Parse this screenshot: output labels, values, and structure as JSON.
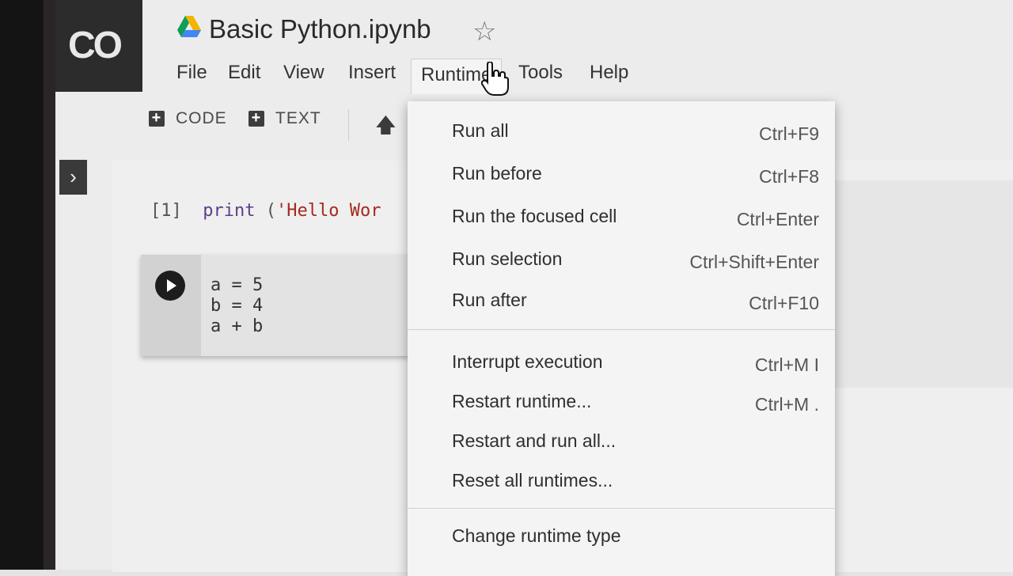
{
  "app": {
    "logo": "CO",
    "title": "Basic Python.ipynb"
  },
  "menubar": {
    "items": [
      "File",
      "Edit",
      "View",
      "Insert",
      "Runtime",
      "Tools",
      "Help"
    ]
  },
  "toolbar": {
    "code_label": "CODE",
    "text_label": "TEXT"
  },
  "cells": {
    "cell1": {
      "exec_count": "[1]",
      "code_keyword": "print",
      "code_paren": " (",
      "code_string": "'Hello Wor"
    },
    "cell2": {
      "lines": [
        "a = 5",
        "b = 4",
        "a + b"
      ]
    }
  },
  "runtime_menu": {
    "items": [
      {
        "label": "Run all",
        "shortcut": "Ctrl+F9"
      },
      {
        "label": "Run before",
        "shortcut": "Ctrl+F8"
      },
      {
        "label": "Run the focused cell",
        "shortcut": "Ctrl+Enter"
      },
      {
        "label": "Run selection",
        "shortcut": "Ctrl+Shift+Enter"
      },
      {
        "label": "Run after",
        "shortcut": "Ctrl+F10"
      },
      {
        "label": "Interrupt execution",
        "shortcut": "Ctrl+M I"
      },
      {
        "label": "Restart runtime...",
        "shortcut": "Ctrl+M ."
      },
      {
        "label": "Restart and run all...",
        "shortcut": ""
      },
      {
        "label": "Reset all runtimes...",
        "shortcut": ""
      },
      {
        "label": "Change runtime type",
        "shortcut": ""
      }
    ]
  },
  "icons": {
    "drive": "google-drive-icon",
    "star": "star-icon",
    "up": "arrow-up-icon",
    "expand": "chevron-right-icon",
    "run": "play-icon",
    "cursor": "hand-pointer-icon"
  },
  "colors": {
    "keyword": "#5a3f8a",
    "string": "#a32b1e",
    "logo_bg": "#2c2c2c"
  }
}
